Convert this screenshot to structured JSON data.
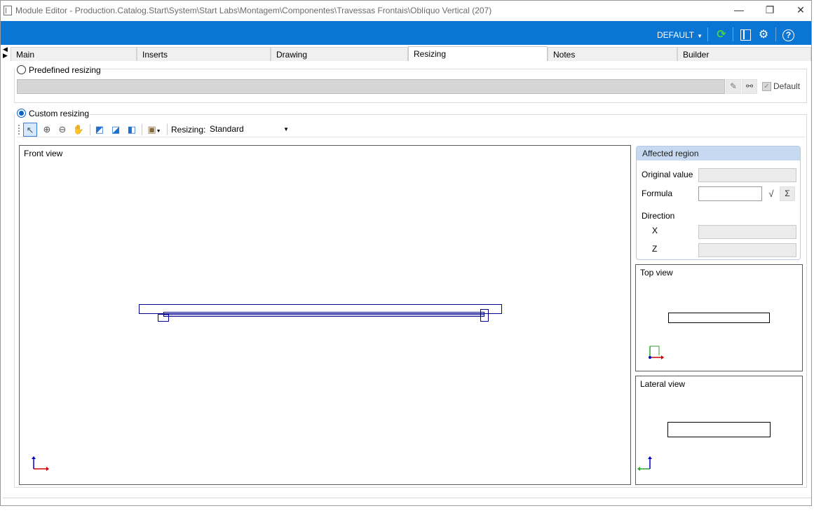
{
  "window": {
    "title": "Module Editor - Production.Catalog.Start\\System\\Start Labs\\Montagem\\Componentes\\Travessas Frontais\\Oblíquo Vertical (207)",
    "minimize_glyph": "—",
    "maximize_glyph": "❐",
    "close_glyph": "✕"
  },
  "ribbon": {
    "profile": "DEFAULT",
    "accent": "#0a75d3"
  },
  "side_arrows": [
    "◀",
    "▶"
  ],
  "tabs": [
    {
      "label": "Main",
      "active": false
    },
    {
      "label": "Inserts",
      "active": false
    },
    {
      "label": "Drawing",
      "active": false
    },
    {
      "label": "Resizing",
      "active": true
    },
    {
      "label": "Notes",
      "active": false
    },
    {
      "label": "Builder",
      "active": false
    }
  ],
  "predefined": {
    "label": "Predefined resizing",
    "selected": false,
    "input_value": "",
    "default_label": "Default",
    "default_checked": true
  },
  "custom": {
    "label": "Custom resizing",
    "selected": true
  },
  "toolbar": {
    "resizing_label": "Resizing:",
    "resizing_value": "Standard",
    "icons": [
      "pointer-icon",
      "zoom-in-icon",
      "zoom-out-icon",
      "pan-hand-icon",
      "add-region-icon",
      "move-region-icon",
      "remove-region-icon",
      "box-view-icon"
    ]
  },
  "front_view": {
    "title": "Front view"
  },
  "affected_region": {
    "title": "Affected region",
    "original_value_label": "Original value",
    "original_value": "",
    "formula_label": "Formula",
    "formula_value": "",
    "direction_label": "Direction",
    "x_label": "X",
    "x_value": "",
    "z_label": "Z",
    "z_value": "",
    "sqrt_glyph": "√",
    "sum_glyph": "Σ"
  },
  "top_view": {
    "title": "Top view"
  },
  "lateral_view": {
    "title": "Lateral view"
  }
}
